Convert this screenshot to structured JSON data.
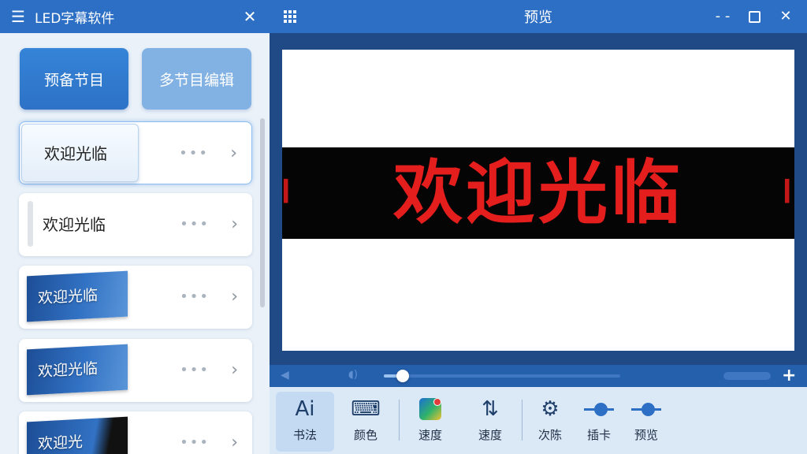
{
  "left_panel": {
    "title": "LED字幕软件",
    "menu_icon": "hamburger-menu-icon",
    "close_icon": "close-icon",
    "buttons": {
      "primary": "预备节目",
      "secondary": "多节目编辑"
    },
    "items": [
      {
        "label": "欢迎光临",
        "active": true
      },
      {
        "label": "欢迎光临"
      },
      {
        "label": "欢迎光临"
      },
      {
        "label": "欢迎光临"
      },
      {
        "label": "欢迎光"
      }
    ],
    "more_glyph": "•••",
    "chevron_glyph": "›"
  },
  "right_panel": {
    "title": "预览",
    "window_controls": {
      "minimize": "- -",
      "close": "✕"
    },
    "preview": {
      "banner_text": "欢迎光临",
      "banner_color": "#e41d1d",
      "background": "#050505"
    },
    "playback": {
      "progress": 0.08,
      "add_label": "+"
    },
    "toolbar": [
      {
        "icon": "ai-text-icon",
        "glyph": "Ai",
        "label": "书法"
      },
      {
        "icon": "keyboard-palette-icon",
        "glyph": "⌨",
        "label": "颜色"
      },
      {
        "icon": "app-effects-icon",
        "glyph": "",
        "label": "速度"
      },
      {
        "icon": "speed-adjust-icon",
        "glyph": "⇅",
        "label": "速度"
      },
      {
        "icon": "settings-gear-icon",
        "glyph": "⚙",
        "label": "次陈"
      },
      {
        "icon": "slider-icon",
        "glyph": "",
        "label": "插卡"
      },
      {
        "icon": "slider-icon",
        "glyph": "",
        "label": "预览"
      }
    ]
  }
}
